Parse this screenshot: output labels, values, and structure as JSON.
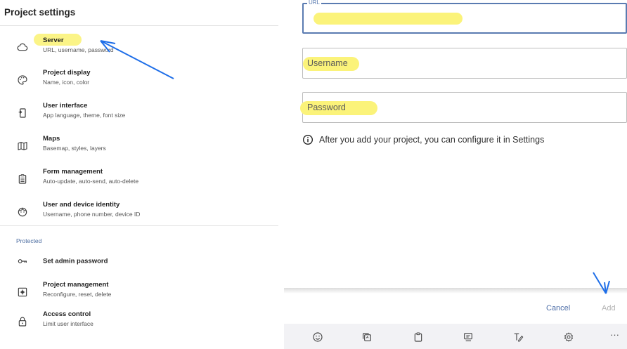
{
  "left": {
    "title": "Project settings",
    "items": [
      {
        "title": "Server",
        "subtitle": "URL, username, password",
        "icon": "cloud-icon"
      },
      {
        "title": "Project display",
        "subtitle": "Name, icon, color",
        "icon": "palette-icon"
      },
      {
        "title": "User interface",
        "subtitle": "App language, theme, font size",
        "icon": "phone-interface-icon"
      },
      {
        "title": "Maps",
        "subtitle": "Basemap, styles, layers",
        "icon": "map-icon"
      },
      {
        "title": "Form management",
        "subtitle": "Auto-update, auto-send, auto-delete",
        "icon": "clipboard-list-icon"
      },
      {
        "title": "User and device identity",
        "subtitle": "Username, phone number, device ID",
        "icon": "face-icon"
      }
    ],
    "protected_label": "Protected",
    "protected_items": [
      {
        "title": "Set admin password",
        "subtitle": "",
        "icon": "key-icon"
      },
      {
        "title": "Project management",
        "subtitle": "Reconfigure, reset, delete",
        "icon": "settings-box-icon"
      },
      {
        "title": "Access control",
        "subtitle": "Limit user interface",
        "icon": "lock-icon"
      }
    ]
  },
  "right": {
    "url_label": "URL",
    "username_placeholder": "Username",
    "password_placeholder": "Password",
    "info_text": "After you add your project, you can configure it in Settings",
    "cancel_label": "Cancel",
    "add_label": "Add",
    "toolbar_icons": [
      "emoji-icon",
      "sticker-icon",
      "clipboard-icon",
      "messages-icon",
      "handwriting-icon",
      "settings-icon",
      "more-icon"
    ],
    "more_glyph": "···"
  },
  "colors": {
    "highlight": "#fbf37a",
    "accent": "#4f6fa8",
    "annotation_arrow": "#1e6ee8"
  }
}
